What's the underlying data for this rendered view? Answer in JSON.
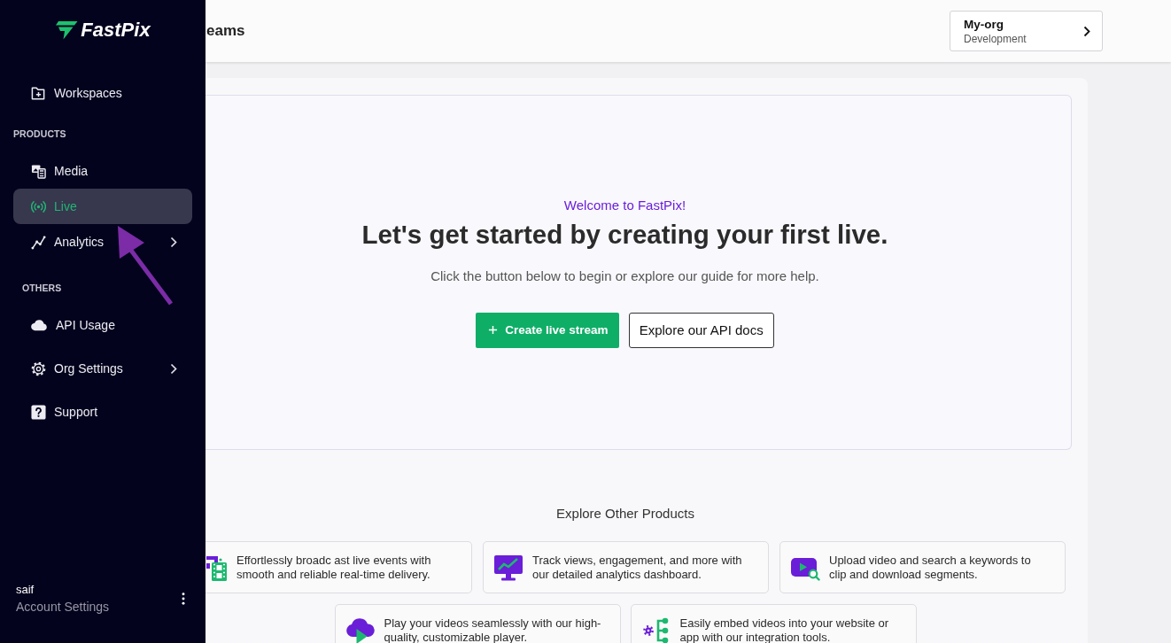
{
  "sidebar": {
    "logo": "FastPix",
    "items": [
      {
        "label": "Workspaces",
        "selected": false,
        "submenu": false
      }
    ],
    "sections": [
      {
        "title": "PRODUCTS",
        "items": [
          {
            "label": "Media",
            "selected": false,
            "submenu": false
          },
          {
            "label": "Live",
            "selected": true,
            "submenu": false
          },
          {
            "label": "Analytics",
            "selected": false,
            "submenu": true
          }
        ]
      },
      {
        "title": "OTHERS",
        "items": [
          {
            "label": "API Usage",
            "selected": false,
            "submenu": false
          },
          {
            "label": "Org Settings",
            "selected": false,
            "submenu": true
          },
          {
            "label": "Support",
            "selected": false,
            "submenu": false
          }
        ]
      }
    ],
    "account": {
      "name": "saif",
      "link": "Account Settings"
    }
  },
  "header": {
    "title": "eams",
    "org_switcher": {
      "name": "My-org",
      "environment": "Development"
    }
  },
  "hero": {
    "welcome": "Welcome to FastPix!",
    "heading": "Let's get started by creating your first live.",
    "description": "Click the button below to begin or explore our guide for more help.",
    "buttons": [
      {
        "label": "Create live stream",
        "kind": "primary"
      },
      {
        "label": "Explore our API docs",
        "kind": "secondary"
      }
    ]
  },
  "products": {
    "title": "Explore Other Products",
    "rows": [
      [
        {
          "description": "Effortlessly broadc ast live events with smooth and reliable real-time delivery."
        },
        {
          "description": "Track views, engagement, and more with our detailed analytics dashboard."
        },
        {
          "description": "Upload video and search a keywords to clip and download segments."
        }
      ],
      [
        {
          "description": "Play your videos seamlessly with our high-quality, customizable player."
        },
        {
          "description": "Easily embed videos into your website or app with our integration tools."
        }
      ]
    ]
  }
}
